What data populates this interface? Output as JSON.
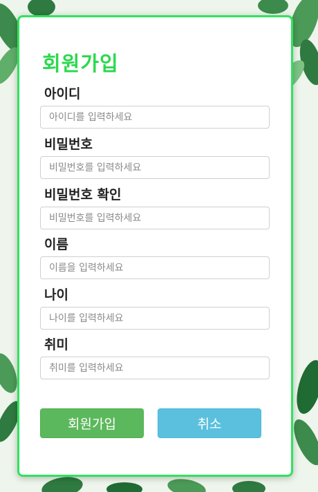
{
  "form": {
    "title": "회원가입",
    "fields": [
      {
        "label": "아이디",
        "placeholder": "아이디를 입력하세요",
        "value": ""
      },
      {
        "label": "비밀번호",
        "placeholder": "비밀번호를 입력하세요",
        "value": ""
      },
      {
        "label": "비밀번호 확인",
        "placeholder": "비밀번호를 입력하세요",
        "value": ""
      },
      {
        "label": "이름",
        "placeholder": "이름을 입력하세요",
        "value": ""
      },
      {
        "label": "나이",
        "placeholder": "나이를 입력하세요",
        "value": ""
      },
      {
        "label": "취미",
        "placeholder": "취미를 입력하세요",
        "value": ""
      }
    ],
    "buttons": {
      "signup_label": "회원가입",
      "cancel_label": "취소"
    }
  },
  "colors": {
    "accent": "#2ad94e",
    "card_border": "#2ee35c",
    "signup_button": "#5cb85c",
    "cancel_button": "#5bc0de"
  }
}
